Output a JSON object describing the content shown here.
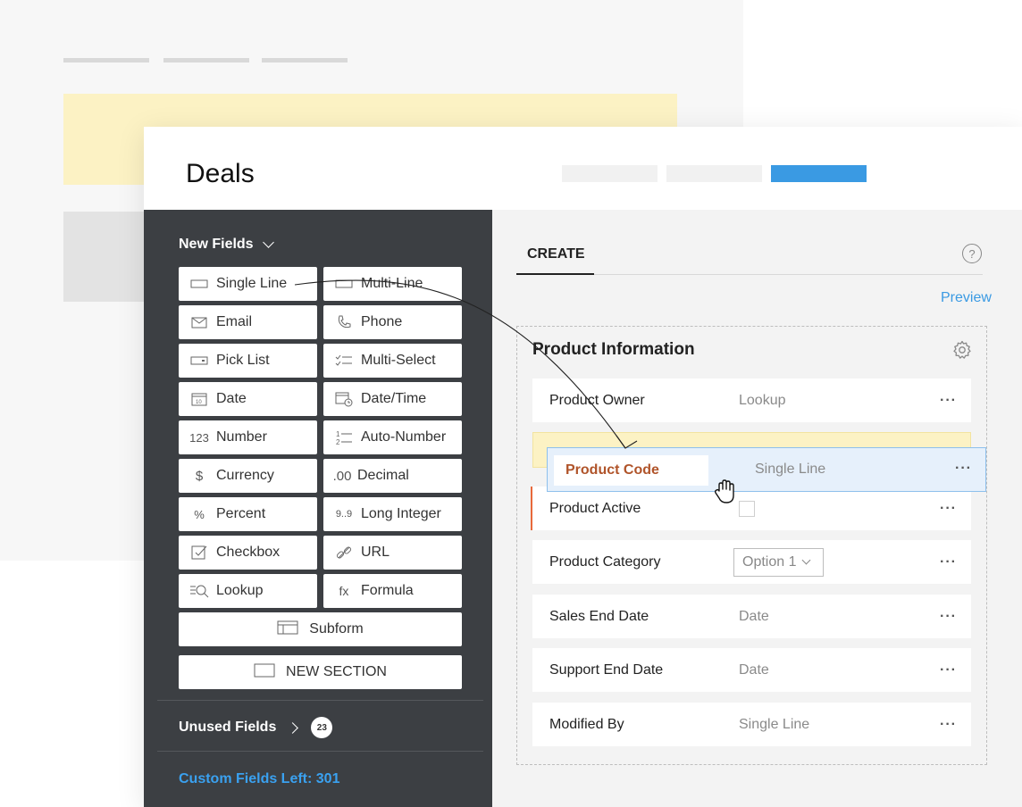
{
  "header": {
    "title": "Deals"
  },
  "left_panel": {
    "new_fields_label": "New Fields",
    "fields": [
      {
        "label": "Single Line",
        "icon": "single-line-icon"
      },
      {
        "label": "Multi-Line",
        "icon": "multi-line-icon"
      },
      {
        "label": "Email",
        "icon": "email-icon"
      },
      {
        "label": "Phone",
        "icon": "phone-icon"
      },
      {
        "label": "Pick List",
        "icon": "pick-list-icon"
      },
      {
        "label": "Multi-Select",
        "icon": "multi-select-icon"
      },
      {
        "label": "Date",
        "icon": "date-icon"
      },
      {
        "label": "Date/Time",
        "icon": "date-time-icon"
      },
      {
        "label": "Number",
        "icon": "number-icon",
        "icon_text": "123"
      },
      {
        "label": "Auto-Number",
        "icon": "auto-number-icon"
      },
      {
        "label": "Currency",
        "icon": "currency-icon",
        "icon_text": "$"
      },
      {
        "label": "Decimal",
        "icon": "decimal-icon",
        "icon_text": ".00"
      },
      {
        "label": "Percent",
        "icon": "percent-icon",
        "icon_text": "%"
      },
      {
        "label": "Long Integer",
        "icon": "long-integer-icon",
        "icon_text": "9..9"
      },
      {
        "label": "Checkbox",
        "icon": "checkbox-icon"
      },
      {
        "label": "URL",
        "icon": "url-icon"
      },
      {
        "label": "Lookup",
        "icon": "lookup-icon"
      },
      {
        "label": "Formula",
        "icon": "formula-icon",
        "icon_text": "fx"
      }
    ],
    "subform_label": "Subform",
    "new_section_label": "NEW SECTION",
    "unused_fields_label": "Unused Fields",
    "unused_count": "23",
    "custom_fields_left": "Custom Fields Left: 301"
  },
  "right_panel": {
    "tab_create": "CREATE",
    "help_label": "?",
    "preview_label": "Preview",
    "section_title": "Product Information",
    "rows": [
      {
        "label": "Product Owner",
        "value": "Lookup"
      },
      {
        "label": "Product Active",
        "value": ""
      },
      {
        "label": "Product Category",
        "value": "Option 1"
      },
      {
        "label": "Sales End Date",
        "value": "Date"
      },
      {
        "label": "Support End Date",
        "value": "Date"
      },
      {
        "label": "Modified By",
        "value": "Single Line"
      }
    ],
    "row_menu": "···",
    "dragged": {
      "label": "Product Code",
      "value": "Single Line"
    }
  },
  "colors": {
    "accent": "#3a9ae3",
    "custom_fields_text": "#3aa1f0",
    "dark_panel": "#3c3f43",
    "drop_zone": "#fcf2c4",
    "dragged_label": "#b0542a",
    "active_marker": "#e8693b"
  }
}
